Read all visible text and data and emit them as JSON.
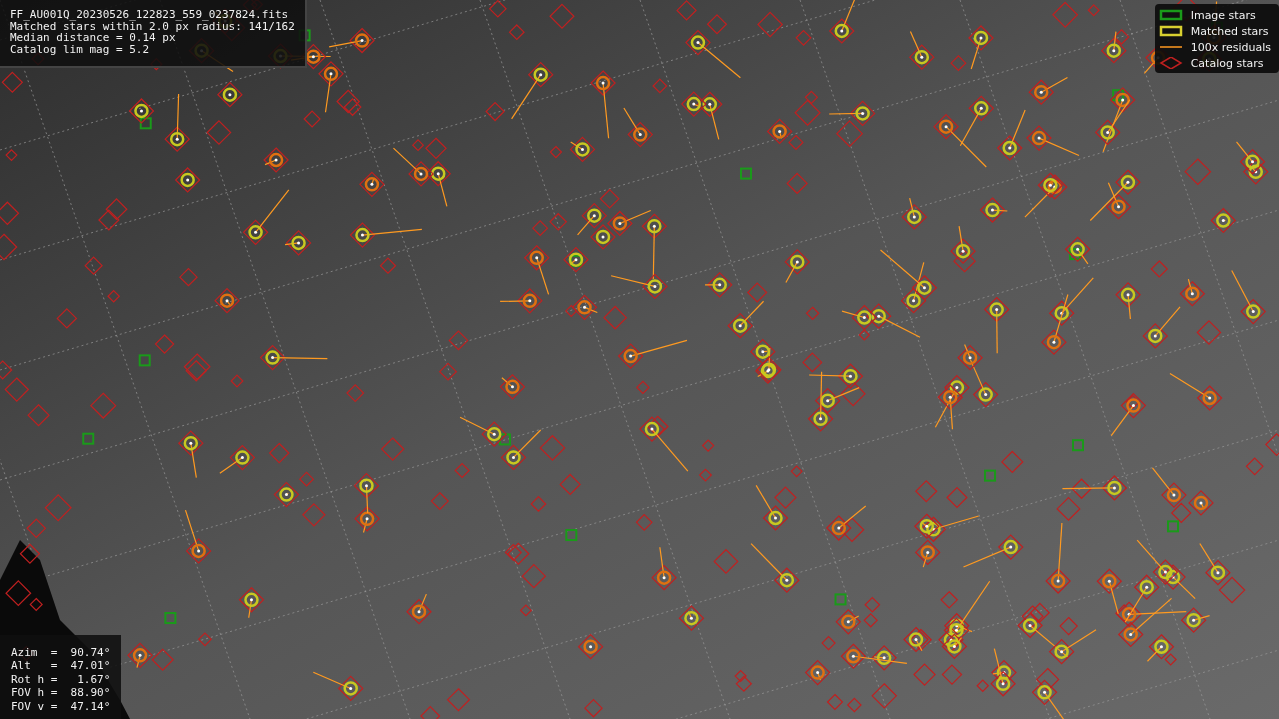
{
  "info": {
    "lines": [
      "FF_AU001Q_20230526_122823_559_0237824.fits",
      "Matched stars within 2.0 px radius: 141/162",
      "Median distance = 0.14 px",
      "Catalog lim mag = 5.2"
    ]
  },
  "legend": [
    {
      "kind": "image",
      "label": "Image stars"
    },
    {
      "kind": "matched",
      "label": "Matched stars"
    },
    {
      "kind": "residual",
      "label": "100x residuals"
    },
    {
      "kind": "catalog",
      "label": "Catalog stars"
    }
  ],
  "pointing": {
    "lines": [
      "Azim  =  90.74°",
      "Alt   =  47.01°",
      "Rot h =   1.67°",
      "FOV h =  88.90°",
      "FOV v =  47.14°"
    ]
  }
}
